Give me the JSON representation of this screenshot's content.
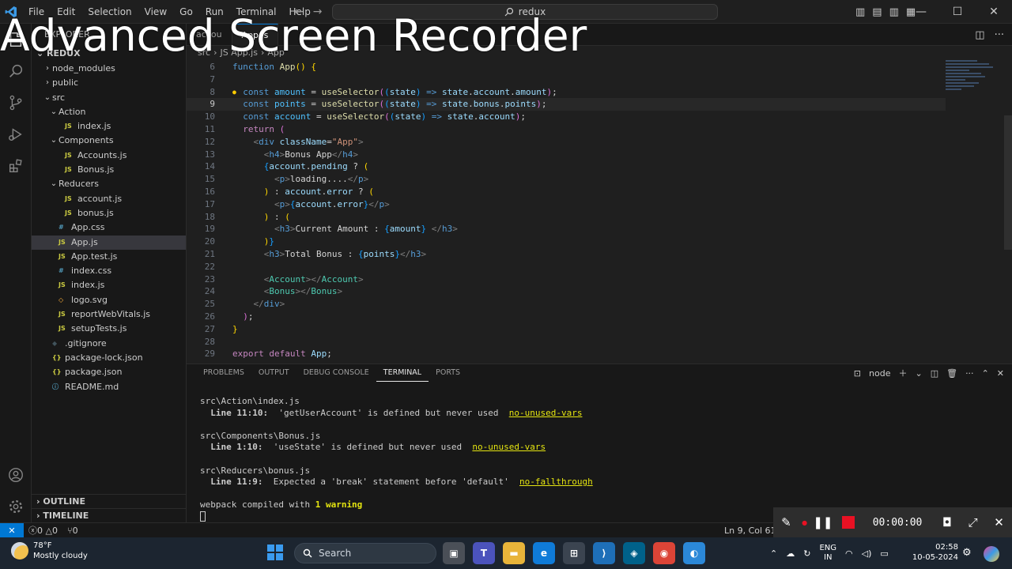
{
  "watermark": "Advanced Screen Recorder",
  "titlebar": {
    "menu": [
      "File",
      "Edit",
      "Selection",
      "View",
      "Go",
      "Run",
      "Terminal",
      "Help"
    ],
    "search_text": "redux"
  },
  "sidebar": {
    "header": "EXPLORER",
    "root": "REDUX",
    "tree": [
      {
        "label": "node_modules",
        "type": "folder",
        "depth": 1,
        "open": false
      },
      {
        "label": "public",
        "type": "folder",
        "depth": 1,
        "open": false
      },
      {
        "label": "src",
        "type": "folder",
        "depth": 1,
        "open": true
      },
      {
        "label": "Action",
        "type": "folder",
        "depth": 2,
        "open": true
      },
      {
        "label": "index.js",
        "type": "js",
        "depth": 3
      },
      {
        "label": "Components",
        "type": "folder",
        "depth": 2,
        "open": true
      },
      {
        "label": "Accounts.js",
        "type": "js",
        "depth": 3
      },
      {
        "label": "Bonus.js",
        "type": "js",
        "depth": 3
      },
      {
        "label": "Reducers",
        "type": "folder",
        "depth": 2,
        "open": true
      },
      {
        "label": "account.js",
        "type": "js",
        "depth": 3
      },
      {
        "label": "bonus.js",
        "type": "js",
        "depth": 3
      },
      {
        "label": "App.css",
        "type": "css",
        "depth": 2
      },
      {
        "label": "App.js",
        "type": "js",
        "depth": 2,
        "active": true
      },
      {
        "label": "App.test.js",
        "type": "js",
        "depth": 2
      },
      {
        "label": "index.css",
        "type": "css",
        "depth": 2
      },
      {
        "label": "index.js",
        "type": "js",
        "depth": 2
      },
      {
        "label": "logo.svg",
        "type": "svg",
        "depth": 2
      },
      {
        "label": "reportWebVitals.js",
        "type": "js",
        "depth": 2
      },
      {
        "label": "setupTests.js",
        "type": "js",
        "depth": 2
      },
      {
        "label": ".gitignore",
        "type": "git",
        "depth": 1
      },
      {
        "label": "package-lock.json",
        "type": "json",
        "depth": 1
      },
      {
        "label": "package.json",
        "type": "json",
        "depth": 1
      },
      {
        "label": "README.md",
        "type": "info",
        "depth": 1
      }
    ],
    "outline": "OUTLINE",
    "timeline": "TIMELINE"
  },
  "editor": {
    "tabs": [
      {
        "label": "accou",
        "active": false
      },
      {
        "label": "App.js",
        "active": true
      }
    ],
    "breadcrumb": [
      "src",
      "JS App.js",
      "App"
    ],
    "lines": [
      {
        "n": "6",
        "tokens": [
          [
            "kw",
            "function "
          ],
          [
            "fn",
            "App"
          ],
          [
            "br1",
            "() {"
          ]
        ]
      },
      {
        "n": "7",
        "tokens": []
      },
      {
        "n": "8",
        "tokens": [
          [
            "kw",
            "  const "
          ],
          [
            "cn",
            "amount"
          ],
          [
            "pl",
            " = "
          ],
          [
            "fn",
            "useSelector"
          ],
          [
            "br2",
            "("
          ],
          [
            "br3",
            "("
          ],
          [
            "vr",
            "state"
          ],
          [
            "br3",
            ")"
          ],
          [
            "kw",
            " =>"
          ],
          [
            "vr",
            " state"
          ],
          [
            "pl",
            "."
          ],
          [
            "vr",
            "account"
          ],
          [
            "pl",
            "."
          ],
          [
            "vr",
            "amount"
          ],
          [
            "br2",
            ")"
          ],
          [
            "pl",
            ";"
          ]
        ]
      },
      {
        "n": "9",
        "tokens": [
          [
            "kw",
            "  const "
          ],
          [
            "cn",
            "points"
          ],
          [
            "pl",
            " = "
          ],
          [
            "fn",
            "useSelector"
          ],
          [
            "br2",
            "("
          ],
          [
            "br3",
            "("
          ],
          [
            "vr",
            "state"
          ],
          [
            "br3",
            ")"
          ],
          [
            "kw",
            " =>"
          ],
          [
            "vr",
            " state"
          ],
          [
            "pl",
            "."
          ],
          [
            "vr",
            "bonus"
          ],
          [
            "pl",
            "."
          ],
          [
            "vr",
            "points"
          ],
          [
            "br2",
            ")"
          ],
          [
            "pl",
            ";"
          ]
        ]
      },
      {
        "n": "10",
        "tokens": [
          [
            "kw",
            "  const "
          ],
          [
            "cn",
            "account"
          ],
          [
            "pl",
            " = "
          ],
          [
            "fn",
            "useSelector"
          ],
          [
            "br2",
            "("
          ],
          [
            "br3",
            "("
          ],
          [
            "vr",
            "state"
          ],
          [
            "br3",
            ")"
          ],
          [
            "kw",
            " =>"
          ],
          [
            "vr",
            " state"
          ],
          [
            "pl",
            "."
          ],
          [
            "vr",
            "account"
          ],
          [
            "br2",
            ")"
          ],
          [
            "pl",
            ";"
          ]
        ]
      },
      {
        "n": "11",
        "tokens": [
          [
            "ctl",
            "  return "
          ],
          [
            "br2",
            "("
          ]
        ]
      },
      {
        "n": "12",
        "tokens": [
          [
            "ang",
            "    <"
          ],
          [
            "tag",
            "div"
          ],
          [
            "vr",
            " className"
          ],
          [
            "pl",
            "="
          ],
          [
            "str",
            "\"App\""
          ],
          [
            "ang",
            ">"
          ]
        ]
      },
      {
        "n": "13",
        "tokens": [
          [
            "ang",
            "      <"
          ],
          [
            "tag",
            "h4"
          ],
          [
            "ang",
            ">"
          ],
          [
            "pl",
            "Bonus App"
          ],
          [
            "ang",
            "</"
          ],
          [
            "tag",
            "h4"
          ],
          [
            "ang",
            ">"
          ]
        ]
      },
      {
        "n": "14",
        "tokens": [
          [
            "br3",
            "      {"
          ],
          [
            "vr",
            "account"
          ],
          [
            "pl",
            "."
          ],
          [
            "vr",
            "pending"
          ],
          [
            "pl",
            " ? "
          ],
          [
            "br1",
            "("
          ]
        ]
      },
      {
        "n": "15",
        "tokens": [
          [
            "ang",
            "        <"
          ],
          [
            "tag",
            "p"
          ],
          [
            "ang",
            ">"
          ],
          [
            "pl",
            "loading...."
          ],
          [
            "ang",
            "</"
          ],
          [
            "tag",
            "p"
          ],
          [
            "ang",
            ">"
          ]
        ]
      },
      {
        "n": "16",
        "tokens": [
          [
            "br1",
            "      ) "
          ],
          [
            "pl",
            ": "
          ],
          [
            "vr",
            "account"
          ],
          [
            "pl",
            "."
          ],
          [
            "vr",
            "error"
          ],
          [
            "pl",
            " ? "
          ],
          [
            "br1",
            "("
          ]
        ]
      },
      {
        "n": "17",
        "tokens": [
          [
            "ang",
            "        <"
          ],
          [
            "tag",
            "p"
          ],
          [
            "ang",
            ">"
          ],
          [
            "br3",
            "{"
          ],
          [
            "vr",
            "account"
          ],
          [
            "pl",
            "."
          ],
          [
            "vr",
            "error"
          ],
          [
            "br3",
            "}"
          ],
          [
            "ang",
            "</"
          ],
          [
            "tag",
            "p"
          ],
          [
            "ang",
            ">"
          ]
        ]
      },
      {
        "n": "18",
        "tokens": [
          [
            "br1",
            "      ) "
          ],
          [
            "pl",
            ": "
          ],
          [
            "br1",
            "("
          ]
        ]
      },
      {
        "n": "19",
        "tokens": [
          [
            "ang",
            "        <"
          ],
          [
            "tag",
            "h3"
          ],
          [
            "ang",
            ">"
          ],
          [
            "pl",
            "Current Amount : "
          ],
          [
            "br3",
            "{"
          ],
          [
            "vr",
            "amount"
          ],
          [
            "br3",
            "}"
          ],
          [
            "pl",
            " "
          ],
          [
            "ang",
            "</"
          ],
          [
            "tag",
            "h3"
          ],
          [
            "ang",
            ">"
          ]
        ]
      },
      {
        "n": "20",
        "tokens": [
          [
            "br1",
            "      )"
          ],
          [
            "br3",
            "}"
          ]
        ]
      },
      {
        "n": "21",
        "tokens": [
          [
            "ang",
            "      <"
          ],
          [
            "tag",
            "h3"
          ],
          [
            "ang",
            ">"
          ],
          [
            "pl",
            "Total Bonus : "
          ],
          [
            "br3",
            "{"
          ],
          [
            "vr",
            "points"
          ],
          [
            "br3",
            "}"
          ],
          [
            "ang",
            "</"
          ],
          [
            "tag",
            "h3"
          ],
          [
            "ang",
            ">"
          ]
        ]
      },
      {
        "n": "22",
        "tokens": []
      },
      {
        "n": "23",
        "tokens": [
          [
            "ang",
            "      <"
          ],
          [
            "tagc",
            "Account"
          ],
          [
            "ang",
            "></"
          ],
          [
            "tagc",
            "Account"
          ],
          [
            "ang",
            ">"
          ]
        ]
      },
      {
        "n": "24",
        "tokens": [
          [
            "ang",
            "      <"
          ],
          [
            "tagc",
            "Bonus"
          ],
          [
            "ang",
            "></"
          ],
          [
            "tagc",
            "Bonus"
          ],
          [
            "ang",
            ">"
          ]
        ]
      },
      {
        "n": "25",
        "tokens": [
          [
            "ang",
            "    </"
          ],
          [
            "tag",
            "div"
          ],
          [
            "ang",
            ">"
          ]
        ]
      },
      {
        "n": "26",
        "tokens": [
          [
            "br2",
            "  )"
          ],
          [
            "pl",
            ";"
          ]
        ]
      },
      {
        "n": "27",
        "tokens": [
          [
            "br1",
            "}"
          ]
        ]
      },
      {
        "n": "28",
        "tokens": []
      },
      {
        "n": "29",
        "tokens": [
          [
            "ctl",
            "export "
          ],
          [
            "ctl",
            "default "
          ],
          [
            "vr",
            "App"
          ],
          [
            "pl",
            ";"
          ]
        ]
      }
    ]
  },
  "panel": {
    "tabs": [
      "PROBLEMS",
      "OUTPUT",
      "DEBUG CONSOLE",
      "TERMINAL",
      "PORTS"
    ],
    "active_tab": "TERMINAL",
    "shell": "node",
    "terminal": {
      "file1": "src\\Action\\index.js",
      "loc1": "  Line 11:10:",
      "msg1": "  'getUserAccount' is defined but never used  ",
      "rule1": "no-unused-vars",
      "file2": "src\\Components\\Bonus.js",
      "loc2": "  Line 1:10:",
      "msg2": "  'useState' is defined but never used  ",
      "rule2": "no-unused-vars",
      "file3": "src\\Reducers\\bonus.js",
      "loc3": "  Line 11:9:",
      "msg3": "  Expected a 'break' statement before 'default'  ",
      "rule3": "no-fallthrough",
      "compiled": "webpack compiled with ",
      "warning": "1 warning"
    }
  },
  "recorder": {
    "timer": "00:00:00"
  },
  "statusbar": {
    "errors": "0",
    "warnings": "0",
    "ports": "0",
    "position": "Ln 9, Col 61"
  },
  "taskbar": {
    "temp": "78°F",
    "weather": "Mostly cloudy",
    "search": "Search",
    "lang1": "ENG",
    "lang2": "IN",
    "time": "02:58",
    "date": "10-05-2024"
  }
}
